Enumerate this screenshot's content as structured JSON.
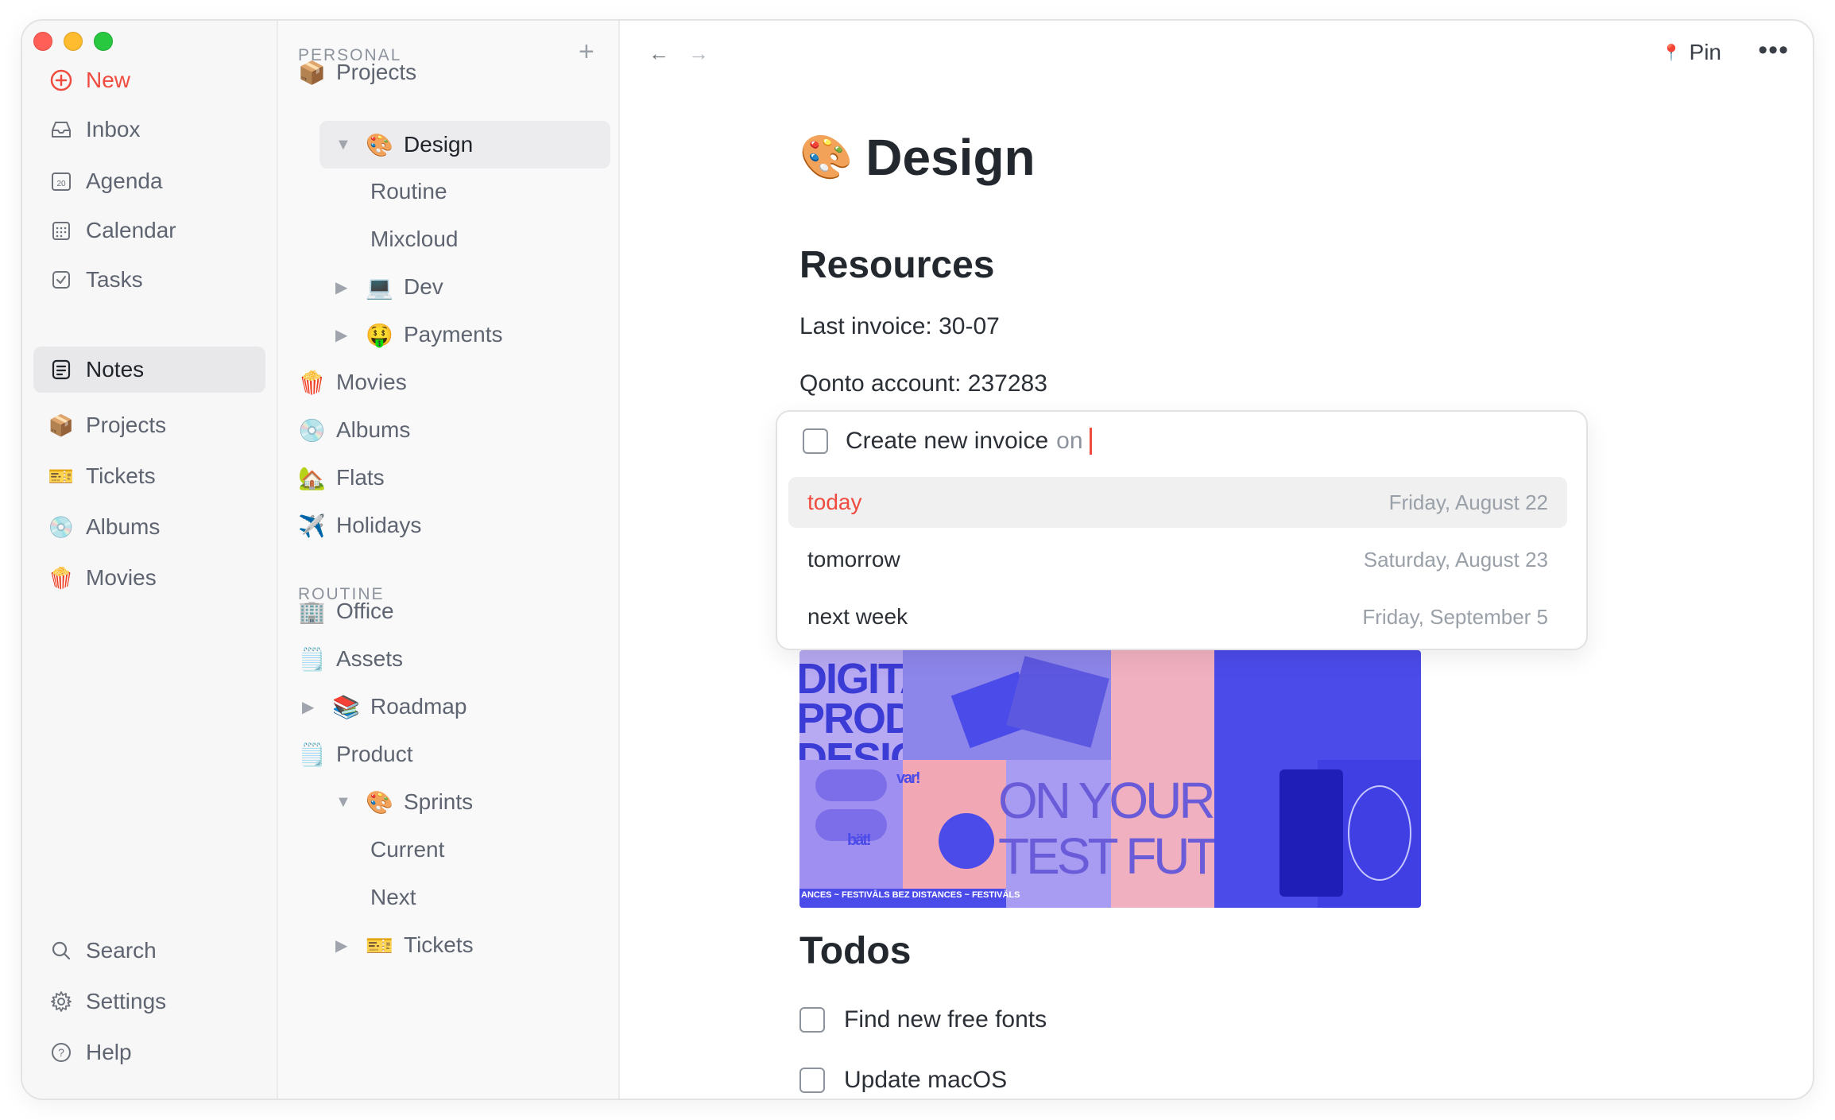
{
  "sidebar": {
    "new_label": "New",
    "items": [
      {
        "label": "Inbox",
        "icon": "inbox-icon"
      },
      {
        "label": "Agenda",
        "icon": "agenda-icon"
      },
      {
        "label": "Calendar",
        "icon": "calendar-icon"
      },
      {
        "label": "Tasks",
        "icon": "tasks-icon"
      },
      {
        "label": "Notes",
        "icon": "notes-icon",
        "active": true
      },
      {
        "label": "Projects",
        "icon": "projects-icon"
      },
      {
        "label": "Tickets",
        "icon": "tickets-icon"
      },
      {
        "label": "Albums",
        "icon": "albums-icon"
      },
      {
        "label": "Movies",
        "icon": "movies-icon"
      }
    ],
    "bottom": [
      {
        "label": "Search",
        "icon": "search-icon"
      },
      {
        "label": "Settings",
        "icon": "gear-icon"
      },
      {
        "label": "Help",
        "icon": "help-icon"
      }
    ]
  },
  "tree": {
    "personal_heading": "PERSONAL",
    "routine_heading": "ROUTINE",
    "personal": [
      {
        "label": "Projects",
        "emoji": "📦"
      },
      {
        "label": "Design",
        "emoji": "🎨",
        "active": true,
        "expanded": true
      },
      {
        "label": "Routine"
      },
      {
        "label": "Mixcloud"
      },
      {
        "label": "Dev",
        "emoji": "💻"
      },
      {
        "label": "Payments",
        "emoji": "🤑"
      },
      {
        "label": "Movies",
        "emoji": "🍿"
      },
      {
        "label": "Albums",
        "emoji": "💿"
      },
      {
        "label": "Flats",
        "emoji": "🏡"
      },
      {
        "label": "Holidays",
        "emoji": "✈️"
      }
    ],
    "routine": [
      {
        "label": "Office",
        "emoji": "🏢"
      },
      {
        "label": "Assets",
        "emoji": "🗒️"
      },
      {
        "label": "Roadmap",
        "emoji": "📚"
      },
      {
        "label": "Product",
        "emoji": "🗒️"
      },
      {
        "label": "Sprints",
        "emoji": "🎨"
      },
      {
        "label": "Current"
      },
      {
        "label": "Next"
      },
      {
        "label": "Tickets",
        "emoji": "🎫"
      }
    ]
  },
  "header": {
    "back_arrow": "←",
    "forward_arrow": "→",
    "pin_label": "Pin",
    "more_label": "•••"
  },
  "page": {
    "emoji": "🎨",
    "title": "Design",
    "resources_heading": "Resources",
    "last_invoice": "Last invoice: 30-07",
    "qonto": "Qonto account: 237283",
    "todos_heading": "Todos",
    "todos": [
      "Find new free fonts",
      "Update macOS"
    ]
  },
  "popup": {
    "input_text": "Create new invoice",
    "input_suffix": "on",
    "options": [
      {
        "label": "today",
        "date": "Friday, August 22",
        "selected": true
      },
      {
        "label": "tomorrow",
        "date": "Saturday, August 23"
      },
      {
        "label": "next week",
        "date": "Friday, September 5"
      }
    ]
  },
  "mosaic": {
    "texts": [
      "DIGITA",
      "PRODU",
      "DESIG",
      "var!",
      "bät!",
      "ON YOUR",
      "TEST FUTU",
      "ANCES ~ FESTIVĀLS BEZ DISTANCES ~ FESTIVĀLS"
    ]
  },
  "colors": {
    "accent": "#ef4b3f",
    "mosaic_blue": "#4b4bea"
  }
}
